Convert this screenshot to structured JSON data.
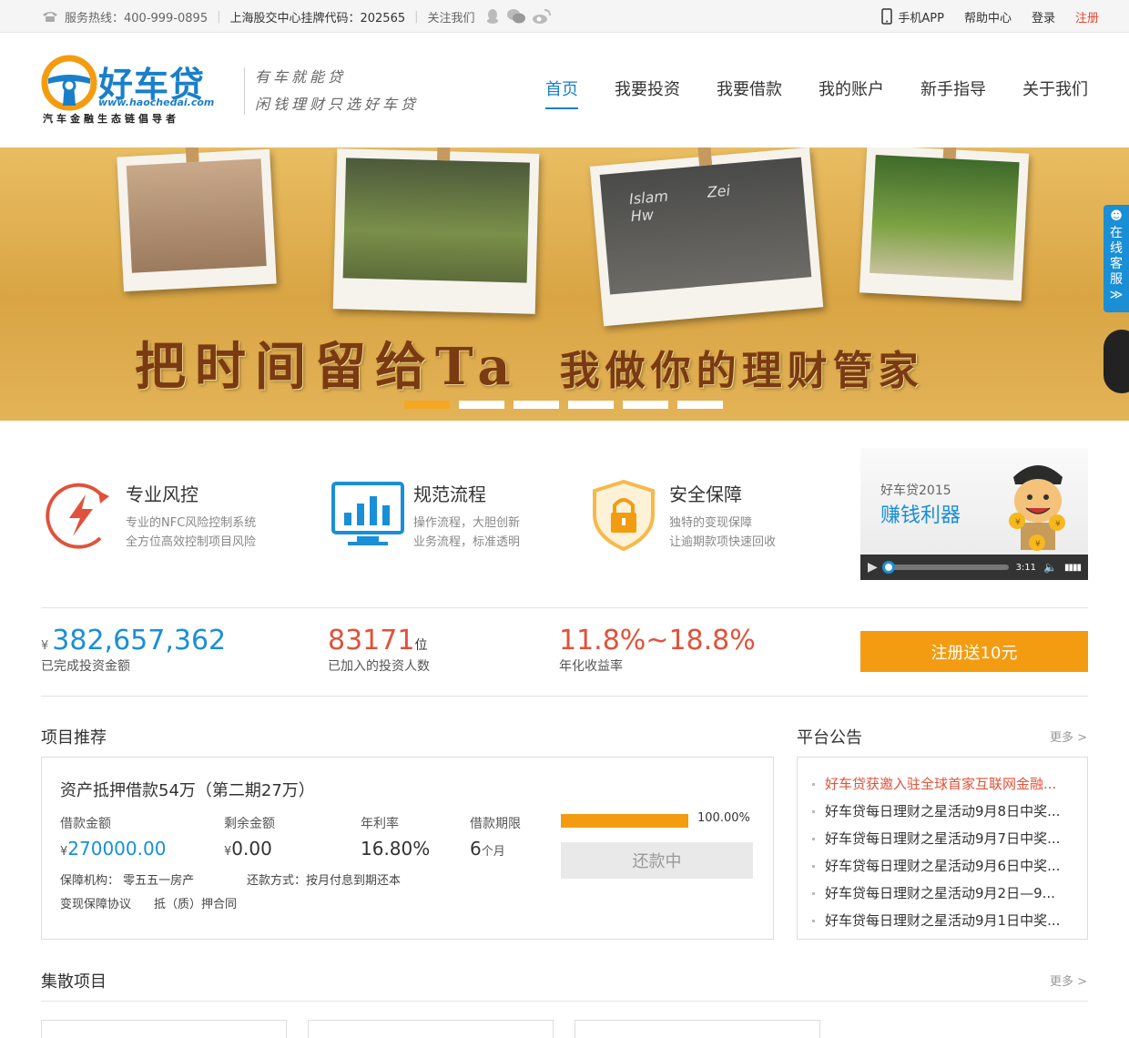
{
  "topbar": {
    "hotline": "服务热线：400-999-0895",
    "listing": "上海股交中心挂牌代码：202565",
    "follow": "关注我们",
    "social_icons": [
      "qq-icon",
      "wechat-icon",
      "weibo-icon"
    ],
    "app": "手机APP",
    "help": "帮助中心",
    "login": "登录",
    "register": "注册"
  },
  "header": {
    "logo_name": "好车贷",
    "logo_url": "www.haochedai.com",
    "logo_sub": "汽车金融生态链倡导者",
    "slogan_line1": "有车就能贷",
    "slogan_line2": "闲钱理财只选好车贷",
    "nav": [
      "首页",
      "我要投资",
      "我要借款",
      "我的账户",
      "新手指导",
      "关于我们"
    ],
    "active_index": 0
  },
  "banner": {
    "headline": "把时间留给Ta",
    "subline": "我做你的理财管家",
    "photo_text": [
      "Islam",
      "Zei",
      "Hw"
    ],
    "slide_count": 6,
    "active_slide": 0
  },
  "kefu": {
    "chars": [
      "在",
      "线",
      "客",
      "服"
    ],
    "arrow": "≫"
  },
  "features": [
    {
      "icon": "lightning-icon",
      "title": "专业风控",
      "desc1": "专业的NFC风险控制系统",
      "desc2": "全方位高效控制项目风险"
    },
    {
      "icon": "bar-chart-monitor-icon",
      "title": "规范流程",
      "desc1": "操作流程，大胆创新",
      "desc2": "业务流程，标准透明"
    },
    {
      "icon": "lock-shield-icon",
      "title": "安全保障",
      "desc1": "独特的变现保障",
      "desc2": "让逾期款项快速回收"
    }
  ],
  "video": {
    "title1": "好车贷2015",
    "title2": "赚钱利器",
    "time": "3:11",
    "coin_symbol": "¥"
  },
  "stats": {
    "yen": "¥",
    "invest_total": "382,657,362",
    "invest_label": "已完成投资金额",
    "investors": "83171",
    "investors_unit": "位",
    "investors_label": "已加入的投资人数",
    "rate": "11.8%~18.8%",
    "rate_label": "年化收益率",
    "register_btn": "注册送10元"
  },
  "projects": {
    "title": "项目推荐",
    "item": {
      "name": "资产抵押借款54万（第二期27万）",
      "amount_label": "借款金额",
      "amount_yen": "¥",
      "amount": "270000.00",
      "remain_label": "剩余金额",
      "remain_yen": "¥",
      "remain": "0.00",
      "rate_label": "年利率",
      "rate": "16.80%",
      "term_label": "借款期限",
      "term": "6",
      "term_unit": "个月",
      "progress_pct": 100,
      "progress_text": "100.00%",
      "status": "还款中",
      "guarantee": "保障机构： 零五五一房产",
      "repay_method": "还款方式：按月付息到期还本",
      "doc1": "变现保障协议",
      "doc2": "抵（质）押合同"
    }
  },
  "notice": {
    "title": "平台公告",
    "more": "更多 >",
    "items": [
      "好车贷获邀入驻全球首家互联网金融...",
      "好车贷每日理财之星活动9月8日中奖...",
      "好车贷每日理财之星活动9月7日中奖...",
      "好车贷每日理财之星活动9月6日中奖...",
      "好车贷每日理财之星活动9月2日—9...",
      "好车贷每日理财之星活动9月1日中奖..."
    ]
  },
  "scatter": {
    "title": "集散项目",
    "more": "更多 >"
  },
  "colors": {
    "brand_blue": "#1a8fd6",
    "accent_orange": "#f39c12",
    "accent_red": "#e0523b"
  }
}
